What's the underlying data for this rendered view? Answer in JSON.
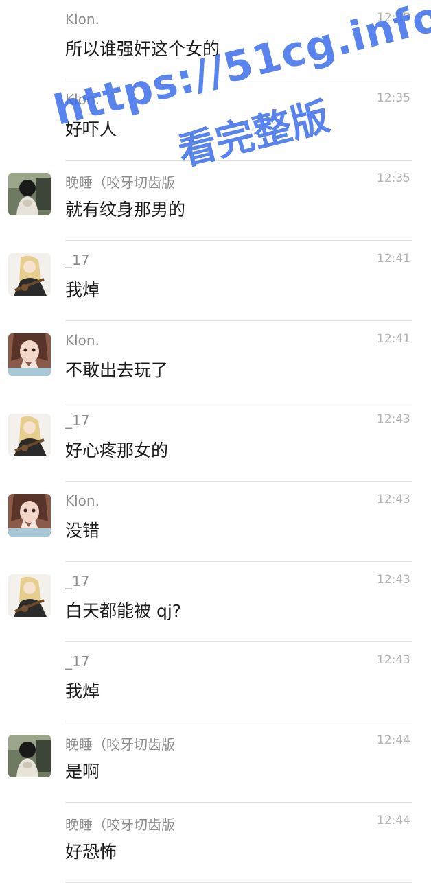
{
  "messages": [
    {
      "sender": "Klon.",
      "time": "12:35",
      "text": "所以谁强奸这个女的",
      "avatar": "none"
    },
    {
      "sender": "Klon.",
      "time": "12:35",
      "text": "好吓人",
      "avatar": "none"
    },
    {
      "sender": "晚睡（咬牙切齿版",
      "time": "12:35",
      "text": "就有纹身那男的",
      "avatar": "avatar-dark"
    },
    {
      "sender": "_17",
      "time": "12:41",
      "text": "我焯",
      "avatar": "avatar-anime"
    },
    {
      "sender": "Klon.",
      "time": "12:41",
      "text": "不敢出去玩了",
      "avatar": "avatar-girl"
    },
    {
      "sender": "_17",
      "time": "12:43",
      "text": "好心疼那女的",
      "avatar": "avatar-anime"
    },
    {
      "sender": "Klon.",
      "time": "12:43",
      "text": "没错",
      "avatar": "avatar-girl"
    },
    {
      "sender": "_17",
      "time": "12:43",
      "text": "白天都能被 qj?",
      "avatar": "avatar-anime"
    },
    {
      "sender": "_17",
      "time": "12:43",
      "text": "我焯",
      "avatar": "none"
    },
    {
      "sender": "晚睡（咬牙切齿版",
      "time": "12:44",
      "text": "是啊",
      "avatar": "avatar-dark"
    },
    {
      "sender": "晚睡（咬牙切齿版",
      "time": "12:44",
      "text": "好恐怖",
      "avatar": "none"
    }
  ],
  "watermark": {
    "url": "https://51cg.info/",
    "label": "看完整版",
    "color": "#3c6eeb"
  },
  "colors": {
    "sender": "#8d8d8d",
    "time": "#b4b4b4",
    "text": "#1b1b1b",
    "divider": "#e3e3e3"
  }
}
